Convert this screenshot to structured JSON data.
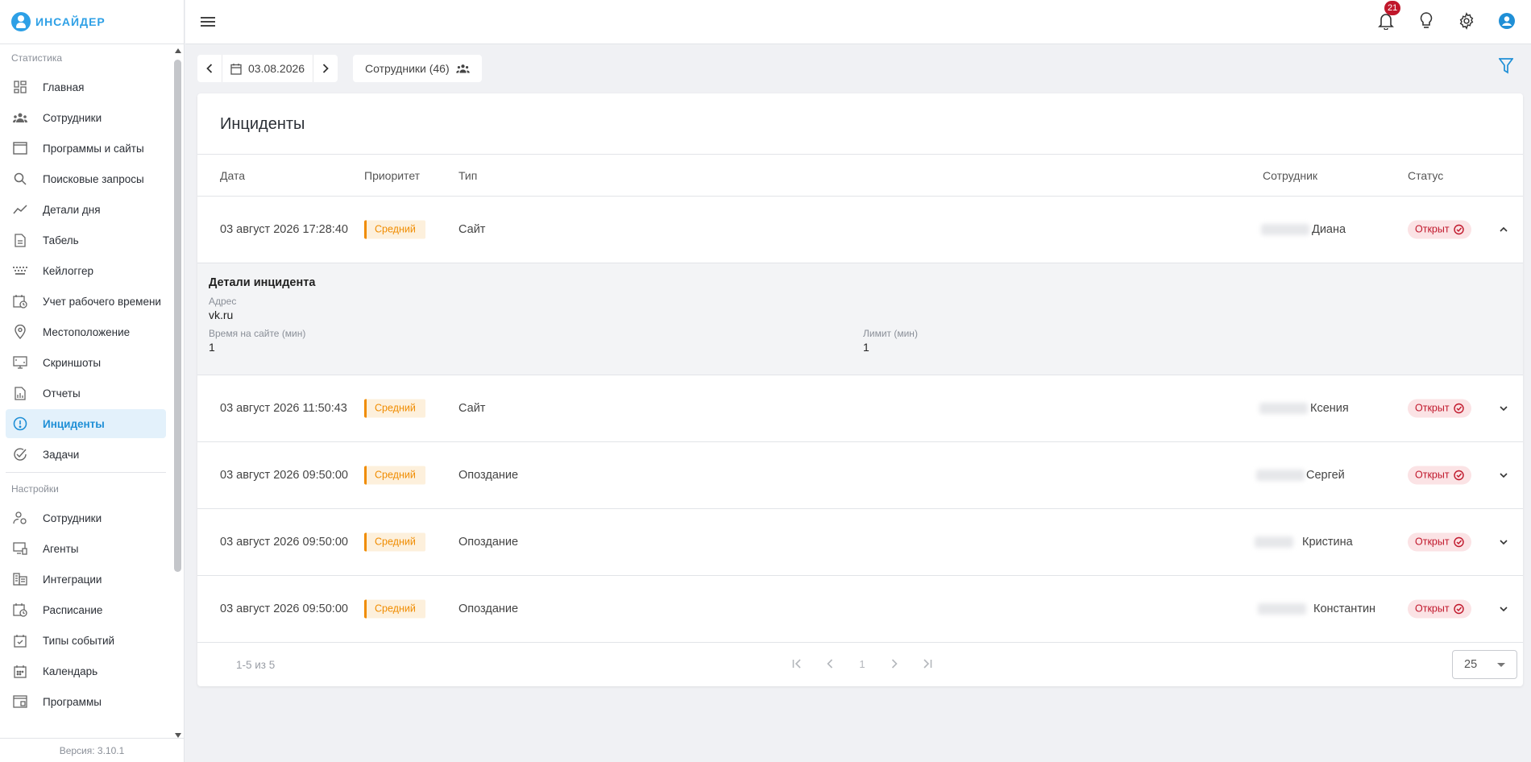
{
  "app": {
    "logo_text": "ИНСАЙДЕР",
    "version": "Версия: 3.10.1"
  },
  "sidebar": {
    "stats_section": "Статистика",
    "stats_items": [
      {
        "label": "Главная",
        "icon": "dashboard-icon"
      },
      {
        "label": "Сотрудники",
        "icon": "people-icon"
      },
      {
        "label": "Программы и сайты",
        "icon": "window-icon"
      },
      {
        "label": "Поисковые запросы",
        "icon": "search-icon"
      },
      {
        "label": "Детали дня",
        "icon": "trend-icon"
      },
      {
        "label": "Табель",
        "icon": "document-icon"
      },
      {
        "label": "Кейлоггер",
        "icon": "keyboard-icon"
      },
      {
        "label": "Учет рабочего времени",
        "icon": "calendar-clock-icon"
      },
      {
        "label": "Местоположение",
        "icon": "location-pin-icon"
      },
      {
        "label": "Скриншоты",
        "icon": "screenshot-icon"
      },
      {
        "label": "Отчеты",
        "icon": "report-icon"
      },
      {
        "label": "Инциденты",
        "icon": "alert-icon",
        "active": true
      },
      {
        "label": "Задачи",
        "icon": "check-circle-icon"
      }
    ],
    "settings_section": "Настройки",
    "settings_items": [
      {
        "label": "Сотрудники",
        "icon": "user-settings-icon"
      },
      {
        "label": "Агенты",
        "icon": "agents-icon"
      },
      {
        "label": "Интеграции",
        "icon": "integrations-icon"
      },
      {
        "label": "Расписание",
        "icon": "schedule-icon"
      },
      {
        "label": "Типы событий",
        "icon": "event-types-icon"
      },
      {
        "label": "Календарь",
        "icon": "calendar-icon"
      },
      {
        "label": "Программы",
        "icon": "programs-icon"
      }
    ]
  },
  "topbar": {
    "notifications_count": "21"
  },
  "toolbar": {
    "date": "03.08.2026",
    "employees_button": "Сотрудники (46)"
  },
  "incidents": {
    "title": "Инциденты",
    "columns": {
      "date": "Дата",
      "priority": "Приоритет",
      "type": "Тип",
      "employee": "Сотрудник",
      "status": "Статус"
    },
    "rows": [
      {
        "date": "03 август 2026 17:28:40",
        "priority": "Средний",
        "type": "Сайт",
        "employee": "Диана",
        "status": "Открыт",
        "expanded": true
      },
      {
        "date": "03 август 2026 11:50:43",
        "priority": "Средний",
        "type": "Сайт",
        "employee": "Ксения",
        "status": "Открыт"
      },
      {
        "date": "03 август 2026 09:50:00",
        "priority": "Средний",
        "type": "Опоздание",
        "employee": "Сергей",
        "status": "Открыт"
      },
      {
        "date": "03 август 2026 09:50:00",
        "priority": "Средний",
        "type": "Опоздание",
        "employee": "Кристина",
        "status": "Открыт"
      },
      {
        "date": "03 август 2026 09:50:00",
        "priority": "Средний",
        "type": "Опоздание",
        "employee": "Константин",
        "status": "Открыт"
      }
    ],
    "details": {
      "title": "Детали инцидента",
      "address_label": "Адрес",
      "address_value": "vk.ru",
      "time_label": "Время на сайте (мин)",
      "time_value": "1",
      "limit_label": "Лимит (мин)",
      "limit_value": "1"
    },
    "pagination": {
      "range": "1-5 из 5",
      "current_page": "1",
      "per_page": "25"
    }
  },
  "colors": {
    "accent": "#1f8fd6",
    "priority": "#f08c00",
    "status": "#c0172b"
  }
}
